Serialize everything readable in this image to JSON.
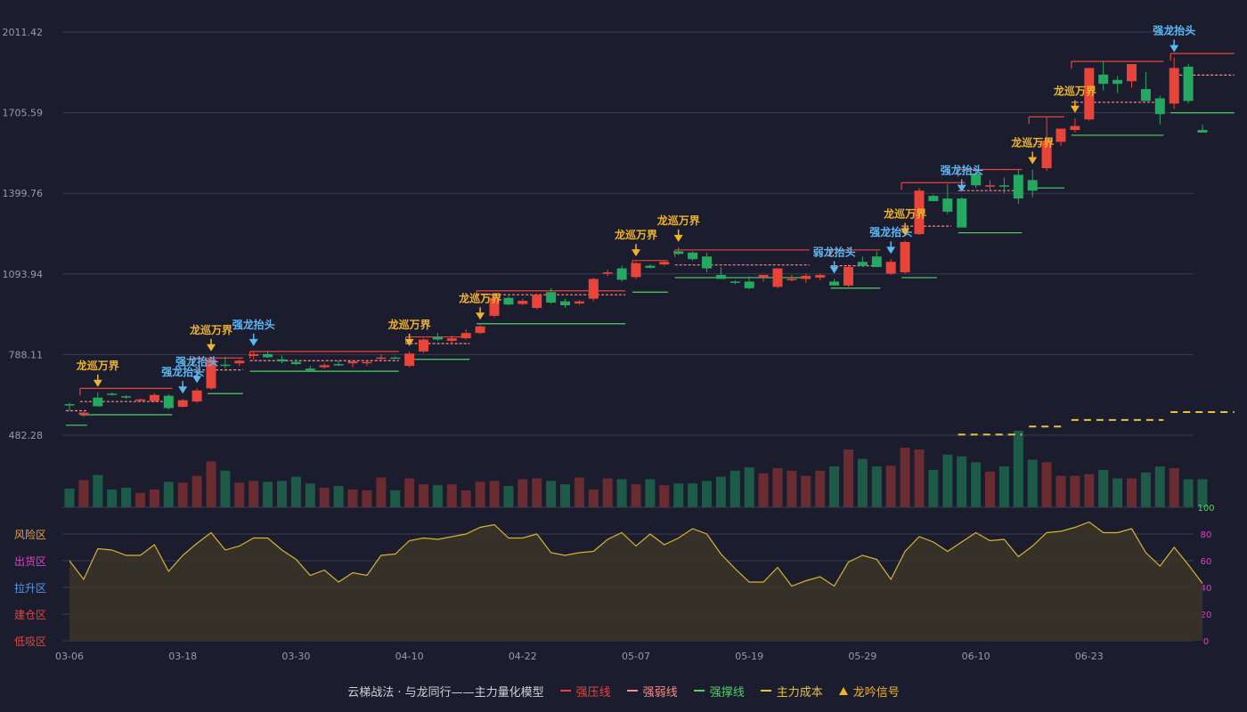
{
  "colors": {
    "background": "#1b1c2e",
    "grid": "#3a3b50",
    "axis_text": "#9a9aa8",
    "up": "#e8443a",
    "down": "#25a85f",
    "resist": "#e8443a",
    "weak": "#ff8a8a",
    "support": "#4fd166",
    "cost": "#e8c23a",
    "long_signal": "#f0b429",
    "strong_signal": "#5cb8f5",
    "osc_line": "#d8b42c",
    "osc_fill": "#3a3528",
    "vol_up": "#6a2c30",
    "vol_down": "#1e5a48"
  },
  "chart_data": {
    "type": "candlestick",
    "price_ticks": [
      "482.28",
      "788.11",
      "1093.94",
      "1399.76",
      "1705.59",
      "2011.42"
    ],
    "price_range": [
      482.28,
      2011.42
    ],
    "x_ticks": [
      {
        "label": "03-06",
        "i": 0
      },
      {
        "label": "03-18",
        "i": 8
      },
      {
        "label": "03-30",
        "i": 16
      },
      {
        "label": "04-10",
        "i": 24
      },
      {
        "label": "04-22",
        "i": 32
      },
      {
        "label": "05-07",
        "i": 40
      },
      {
        "label": "05-19",
        "i": 48
      },
      {
        "label": "05-29",
        "i": 56
      },
      {
        "label": "06-10",
        "i": 64
      },
      {
        "label": "06-23",
        "i": 72
      }
    ],
    "candles": [
      [
        600,
        605,
        575,
        598
      ],
      [
        560,
        572,
        552,
        568
      ],
      [
        625,
        645,
        590,
        592
      ],
      [
        640,
        645,
        632,
        637
      ],
      [
        630,
        635,
        620,
        625
      ],
      [
        615,
        622,
        610,
        618
      ],
      [
        612,
        642,
        608,
        635
      ],
      [
        632,
        638,
        580,
        585
      ],
      [
        590,
        620,
        588,
        615
      ],
      [
        610,
        660,
        605,
        652
      ],
      [
        660,
        780,
        655,
        770
      ],
      [
        750,
        780,
        735,
        745
      ],
      [
        755,
        770,
        745,
        765
      ],
      [
        783,
        800,
        770,
        790
      ],
      [
        790,
        800,
        775,
        778
      ],
      [
        770,
        785,
        755,
        762
      ],
      [
        760,
        770,
        748,
        752
      ],
      [
        735,
        745,
        722,
        728
      ],
      [
        740,
        755,
        735,
        748
      ],
      [
        752,
        765,
        745,
        747
      ],
      [
        755,
        768,
        740,
        762
      ],
      [
        757,
        765,
        745,
        760
      ],
      [
        775,
        790,
        765,
        777
      ],
      [
        777,
        780,
        772,
        775
      ],
      [
        745,
        800,
        740,
        792
      ],
      [
        800,
        850,
        795,
        845
      ],
      [
        855,
        870,
        840,
        845
      ],
      [
        840,
        860,
        830,
        850
      ],
      [
        850,
        885,
        845,
        870
      ],
      [
        870,
        900,
        865,
        895
      ],
      [
        935,
        1010,
        930,
        1003
      ],
      [
        1003,
        1010,
        975,
        978
      ],
      [
        980,
        1000,
        975,
        992
      ],
      [
        965,
        1020,
        960,
        1015
      ],
      [
        1025,
        1040,
        980,
        985
      ],
      [
        990,
        1000,
        965,
        975
      ],
      [
        982,
        995,
        977,
        990
      ],
      [
        1000,
        1080,
        990,
        1075
      ],
      [
        1095,
        1110,
        1085,
        1100
      ],
      [
        1115,
        1125,
        1065,
        1072
      ],
      [
        1082,
        1140,
        1075,
        1135
      ],
      [
        1125,
        1130,
        1115,
        1117
      ],
      [
        1130,
        1145,
        1125,
        1140
      ],
      [
        1180,
        1195,
        1165,
        1170
      ],
      [
        1175,
        1180,
        1145,
        1150
      ],
      [
        1160,
        1175,
        1100,
        1115
      ],
      [
        1090,
        1120,
        1075,
        1075
      ],
      [
        1065,
        1070,
        1055,
        1063
      ],
      [
        1065,
        1085,
        1035,
        1040
      ],
      [
        1080,
        1090,
        1065,
        1090
      ],
      [
        1045,
        1110,
        1040,
        1115
      ],
      [
        1070,
        1090,
        1065,
        1075
      ],
      [
        1075,
        1095,
        1060,
        1087
      ],
      [
        1080,
        1095,
        1070,
        1090
      ],
      [
        1065,
        1075,
        1050,
        1050
      ],
      [
        1050,
        1130,
        1045,
        1120
      ],
      [
        1140,
        1160,
        1120,
        1125
      ],
      [
        1160,
        1180,
        1140,
        1120
      ],
      [
        1095,
        1150,
        1090,
        1140
      ],
      [
        1100,
        1220,
        1095,
        1215
      ],
      [
        1245,
        1420,
        1240,
        1410
      ],
      [
        1390,
        1395,
        1375,
        1370
      ],
      [
        1380,
        1435,
        1320,
        1330
      ],
      [
        1380,
        1385,
        1270,
        1270
      ],
      [
        1475,
        1485,
        1420,
        1430
      ],
      [
        1430,
        1450,
        1410,
        1430
      ],
      [
        1430,
        1460,
        1400,
        1425
      ],
      [
        1470,
        1490,
        1360,
        1380
      ],
      [
        1450,
        1490,
        1385,
        1410
      ],
      [
        1495,
        1690,
        1485,
        1600
      ],
      [
        1595,
        1645,
        1580,
        1645
      ],
      [
        1640,
        1685,
        1630,
        1655
      ],
      [
        1680,
        1875,
        1675,
        1875
      ],
      [
        1850,
        1900,
        1790,
        1815
      ],
      [
        1830,
        1845,
        1780,
        1815
      ],
      [
        1825,
        1885,
        1800,
        1890
      ],
      [
        1795,
        1860,
        1755,
        1750
      ],
      [
        1760,
        1770,
        1660,
        1700
      ],
      [
        1740,
        1915,
        1720,
        1875
      ],
      [
        1880,
        1890,
        1740,
        1750
      ],
      [
        1640,
        1660,
        1630,
        1630
      ]
    ],
    "volumes": [
      22,
      32,
      38,
      21,
      23,
      17,
      21,
      30,
      29,
      37,
      54,
      43,
      29,
      31,
      30,
      31,
      36,
      28,
      23,
      25,
      21,
      20,
      35,
      20,
      34,
      27,
      26,
      27,
      20,
      30,
      31,
      25,
      33,
      34,
      31,
      27,
      35,
      21,
      34,
      33,
      27,
      33,
      26,
      28,
      28,
      31,
      36,
      43,
      47,
      40,
      46,
      43,
      37,
      43,
      48,
      68,
      57,
      48,
      49,
      70,
      68,
      44,
      62,
      60,
      53,
      42,
      48,
      90,
      56,
      53,
      37,
      37,
      39,
      44,
      34,
      34,
      41,
      48,
      46,
      33,
      33
    ],
    "oscillator": {
      "ticks": [
        "0",
        "20",
        "40",
        "60",
        "80",
        "100"
      ],
      "zones": [
        "风险区",
        "出货区",
        "拉升区",
        "建仓区",
        "低吸区"
      ],
      "values": [
        60,
        46,
        69,
        68,
        64,
        64,
        72,
        52,
        64,
        73,
        81,
        68,
        71,
        77,
        77,
        68,
        61,
        49,
        53,
        44,
        51,
        49,
        64,
        65,
        75,
        77,
        76,
        78,
        80,
        85,
        87,
        77,
        77,
        80,
        66,
        64,
        66,
        67,
        76,
        81,
        71,
        80,
        72,
        77,
        84,
        80,
        65,
        54,
        44,
        44,
        55,
        41,
        45,
        48,
        41,
        59,
        64,
        61,
        46,
        67,
        78,
        74,
        67,
        74,
        81,
        75,
        76,
        63,
        71,
        81,
        82,
        85,
        89,
        81,
        81,
        84,
        66,
        56,
        70,
        57,
        43
      ]
    },
    "resistance_levels": [
      {
        "from": 1,
        "to": 7,
        "y": 660
      },
      {
        "from": 9,
        "to": 12,
        "y": 775
      },
      {
        "from": 13,
        "to": 23,
        "y": 800
      },
      {
        "from": 24,
        "to": 28,
        "y": 855
      },
      {
        "from": 29,
        "to": 39,
        "y": 1030
      },
      {
        "from": 40,
        "to": 42,
        "y": 1145
      },
      {
        "from": 43,
        "to": 52,
        "y": 1185
      },
      {
        "from": 54,
        "to": 57,
        "y": 1185
      },
      {
        "from": 59,
        "to": 63,
        "y": 1440
      },
      {
        "from": 63,
        "to": 67,
        "y": 1490
      },
      {
        "from": 68,
        "to": 70,
        "y": 1690
      },
      {
        "from": 71,
        "to": 77,
        "y": 1900
      },
      {
        "from": 78,
        "to": 82,
        "y": 1930
      }
    ],
    "weak_levels": [
      {
        "from": 0,
        "to": 1,
        "y": 575
      },
      {
        "from": 1,
        "to": 7,
        "y": 610
      },
      {
        "from": 9,
        "to": 12,
        "y": 730
      },
      {
        "from": 13,
        "to": 23,
        "y": 765
      },
      {
        "from": 24,
        "to": 28,
        "y": 830
      },
      {
        "from": 29,
        "to": 39,
        "y": 1015
      },
      {
        "from": 43,
        "to": 52,
        "y": 1128
      },
      {
        "from": 54,
        "to": 57,
        "y": 1125
      },
      {
        "from": 59,
        "to": 62,
        "y": 1275
      },
      {
        "from": 63,
        "to": 67,
        "y": 1410
      },
      {
        "from": 68,
        "to": 69,
        "y": 1585
      },
      {
        "from": 71,
        "to": 77,
        "y": 1745
      },
      {
        "from": 78,
        "to": 82,
        "y": 1848
      }
    ],
    "support_levels": [
      {
        "from": 0,
        "to": 1,
        "y": 520
      },
      {
        "from": 1,
        "to": 7,
        "y": 560
      },
      {
        "from": 10,
        "to": 12,
        "y": 640
      },
      {
        "from": 13,
        "to": 23,
        "y": 725
      },
      {
        "from": 24,
        "to": 28,
        "y": 770
      },
      {
        "from": 29,
        "to": 39,
        "y": 905
      },
      {
        "from": 40,
        "to": 42,
        "y": 1025
      },
      {
        "from": 43,
        "to": 52,
        "y": 1080
      },
      {
        "from": 54,
        "to": 57,
        "y": 1040
      },
      {
        "from": 59,
        "to": 61,
        "y": 1080
      },
      {
        "from": 63,
        "to": 67,
        "y": 1250
      },
      {
        "from": 68,
        "to": 70,
        "y": 1420
      },
      {
        "from": 71,
        "to": 77,
        "y": 1620
      },
      {
        "from": 78,
        "to": 82,
        "y": 1705
      }
    ],
    "cost_levels": [
      {
        "from": 63,
        "to": 67,
        "y": 485
      },
      {
        "from": 68,
        "to": 70,
        "y": 515
      },
      {
        "from": 71,
        "to": 77,
        "y": 540
      },
      {
        "from": 78,
        "to": 82,
        "y": 570
      }
    ],
    "signals": [
      {
        "i": 2,
        "type": "long",
        "label": "龙巡万界"
      },
      {
        "i": 8,
        "type": "strong",
        "label": "强龙抬头"
      },
      {
        "i": 9,
        "type": "strong",
        "label": "强龙抬头"
      },
      {
        "i": 10,
        "type": "long",
        "label": "龙巡万界"
      },
      {
        "i": 13,
        "type": "strong",
        "label": "强龙抬头"
      },
      {
        "i": 24,
        "type": "long",
        "label": "龙巡万界"
      },
      {
        "i": 29,
        "type": "long",
        "label": "龙巡万界"
      },
      {
        "i": 40,
        "type": "long",
        "label": "龙巡万界"
      },
      {
        "i": 43,
        "type": "long",
        "label": "龙巡万界"
      },
      {
        "i": 54,
        "type": "strong",
        "label": "弱龙抬头"
      },
      {
        "i": 58,
        "type": "strong",
        "label": "强龙抬头"
      },
      {
        "i": 59,
        "type": "long",
        "label": "龙巡万界"
      },
      {
        "i": 63,
        "type": "strong",
        "label": "强龙抬头"
      },
      {
        "i": 68,
        "type": "long",
        "label": "龙巡万界"
      },
      {
        "i": 71,
        "type": "long",
        "label": "龙巡万界"
      },
      {
        "i": 78,
        "type": "strong",
        "label": "强龙抬头"
      }
    ]
  },
  "legend": {
    "title": "云梯战法 · 与龙同行——主力量化模型",
    "items": [
      {
        "key": "resist",
        "label": "强压线"
      },
      {
        "key": "weak",
        "label": "强弱线"
      },
      {
        "key": "support",
        "label": "强撑线"
      },
      {
        "key": "cost",
        "label": "主力成本"
      },
      {
        "key": "signal",
        "label": "龙吟信号"
      }
    ]
  }
}
